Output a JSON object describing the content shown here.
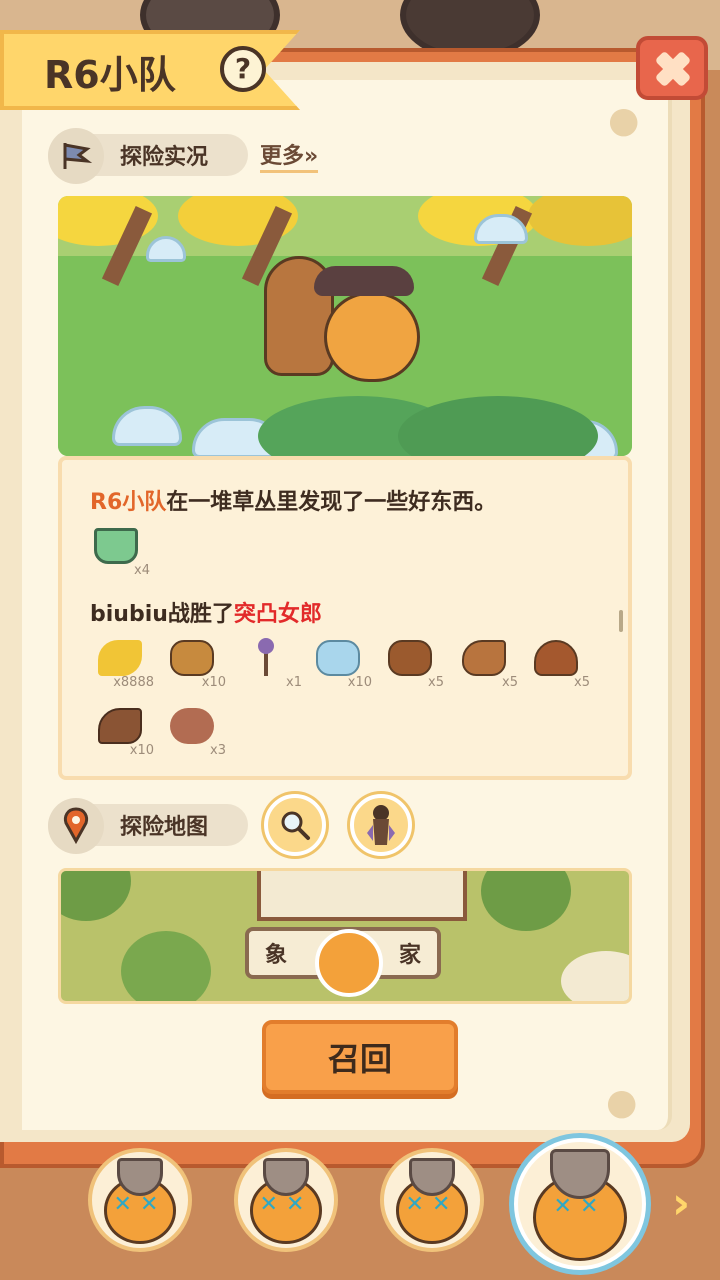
{
  "header": {
    "title": "R6小队",
    "help_label": "?"
  },
  "report_section": {
    "title": "探险实况",
    "more_label": "更多»"
  },
  "log": {
    "entry1": {
      "team": "R6小队",
      "text": "在一堆草丛里发现了一些好东西。",
      "items": [
        {
          "icon": "green-paint-bucket-icon",
          "count": "x4",
          "color": "#7dc98f"
        }
      ]
    },
    "entry2": {
      "name": "biubiu",
      "verb": "战胜了",
      "enemy": "突凸女郎",
      "items": [
        {
          "icon": "banana-icon",
          "count": "x8888",
          "color": "#f1c536"
        },
        {
          "icon": "leopard-head-icon",
          "count": "x10",
          "color": "#c78a3e"
        },
        {
          "icon": "fan-staff-icon",
          "count": "x1",
          "color": "#8a6ab0"
        },
        {
          "icon": "blue-spotted-head-icon",
          "count": "x10",
          "color": "#a9d6ec"
        },
        {
          "icon": "bear-head-icon",
          "count": "x5",
          "color": "#9b5a2e"
        },
        {
          "icon": "horse-head-icon",
          "count": "x5",
          "color": "#b8743e"
        },
        {
          "icon": "turtle-icon",
          "count": "x5",
          "color": "#a4582e"
        },
        {
          "icon": "eagle-icon",
          "count": "x10",
          "color": "#8a5434"
        },
        {
          "icon": "fur-pelt-icon",
          "count": "x3",
          "color": "#b26c52"
        }
      ]
    }
  },
  "map_section": {
    "title": "探险地图",
    "banner_left": "象",
    "banner_right": "家"
  },
  "recall_label": "召回",
  "team": {
    "next_label": "›"
  }
}
